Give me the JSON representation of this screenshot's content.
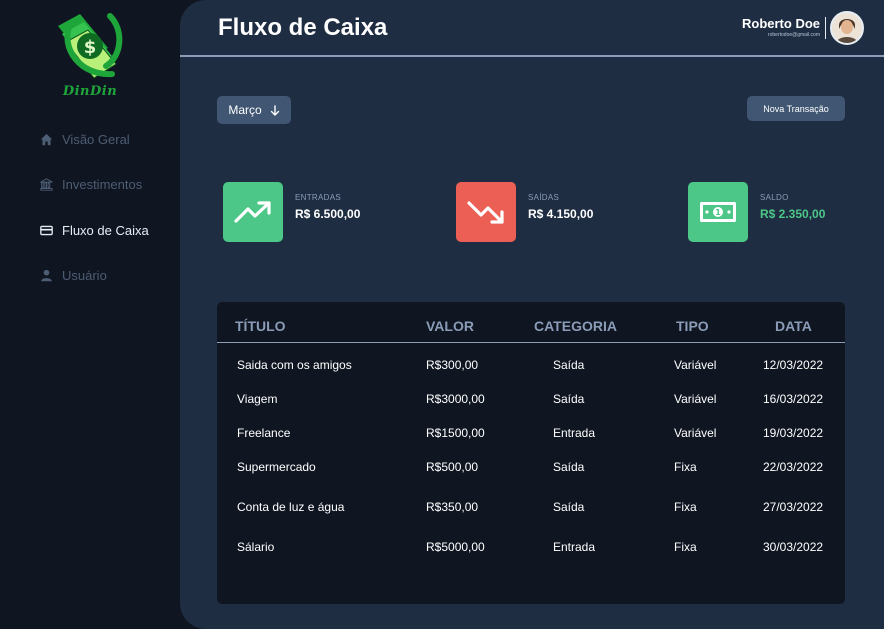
{
  "brand": {
    "name": "DinDin",
    "accent": "#1fa63a"
  },
  "sidebar": {
    "items": [
      {
        "label": "Visão Geral",
        "icon": "home-icon",
        "active": false
      },
      {
        "label": "Investimentos",
        "icon": "bank-icon",
        "active": false
      },
      {
        "label": "Fluxo de Caixa",
        "icon": "credit-card-icon",
        "active": true
      },
      {
        "label": "Usuário",
        "icon": "user-icon",
        "active": false
      }
    ]
  },
  "header": {
    "title": "Fluxo de Caixa",
    "user_name": "Roberto Doe",
    "user_email": "robertodoe@gmail.com"
  },
  "toolbar": {
    "month_label": "Março",
    "new_transaction_label": "Nova Transação"
  },
  "summary": {
    "entradas": {
      "label": "ENTRADAS",
      "value": "R$ 6.500,00",
      "color": "#4cc788",
      "icon": "trending-up-icon"
    },
    "saidas": {
      "label": "SAÍDAS",
      "value": "R$ 4.150,00",
      "color": "#ec5f55",
      "icon": "trending-down-icon"
    },
    "saldo": {
      "label": "SALDO",
      "value": "R$ 2.350,00",
      "color": "#4cc788",
      "icon": "money-icon"
    }
  },
  "table": {
    "headers": [
      "TÍTULO",
      "VALOR",
      "CATEGORIA",
      "TIPO",
      "DATA"
    ],
    "rows": [
      [
        "Saida com os amigos",
        "R$300,00",
        "Saída",
        "Variável",
        "12/03/2022"
      ],
      [
        "Viagem",
        "R$3000,00",
        "Saída",
        "Variável",
        "16/03/2022"
      ],
      [
        "Freelance",
        "R$1500,00",
        "Entrada",
        "Variável",
        "19/03/2022"
      ],
      [
        "Supermercado",
        "R$500,00",
        "Saída",
        "Fixa",
        "22/03/2022"
      ],
      [
        "Conta de luz e água",
        "R$350,00",
        "Saída",
        "Fixa",
        "27/03/2022"
      ],
      [
        "Sálario",
        "R$5000,00",
        "Entrada",
        "Fixa",
        "30/03/2022"
      ]
    ]
  }
}
